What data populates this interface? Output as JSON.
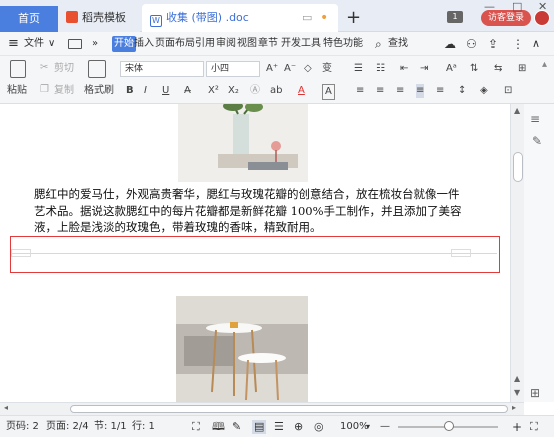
{
  "tabs": {
    "home": "首页",
    "template": "稻壳模板",
    "doc": "收集 (带图) .doc",
    "doc_icon": "W",
    "new_tab": "+",
    "badge": "1",
    "login": "访客登录"
  },
  "window": {
    "minimize": "—",
    "restore": "□",
    "close": "✕"
  },
  "menu": {
    "hamburger": "≡",
    "file": "文件",
    "file_arrow": "∨",
    "more": "»",
    "items": [
      "开始",
      "插入",
      "页面布局",
      "引用",
      "审阅",
      "视图",
      "章节",
      "开发工具",
      "特色功能"
    ],
    "search": "查找"
  },
  "toolbar": {
    "paste": "粘贴",
    "cut": "剪切",
    "copy": "复制",
    "format_painter": "格式刷",
    "font_name": "宋体",
    "font_size": "小四",
    "bold": "B",
    "italic": "I",
    "underline": "U",
    "font_color_a": "A",
    "superscript": "X²",
    "subscript": "X₂",
    "grow": "A⁺",
    "shrink": "A⁻"
  },
  "document": {
    "paragraph": "腮红中的爱马仕，外观高贵奢华，腮红与玫瑰花瓣的创意结合，放在梳妆台就像一件艺术品。据说这款腮红中的每片花瓣都是新鲜花瓣 100%手工制作，并且添加了美容液，上脸是浅淡的玫瑰色，带着玫瑰的香味，精致耐用。"
  },
  "status": {
    "page_code": "页码: 2",
    "pages": "页面: 2/4",
    "section": "节: 1/1",
    "row": "行: 1",
    "zoom": "100%",
    "zoom_minus": "—",
    "zoom_plus": "+"
  },
  "colors": {
    "accent": "#4a7fe0",
    "login": "#d9534f",
    "selection": "#e33b3b"
  }
}
